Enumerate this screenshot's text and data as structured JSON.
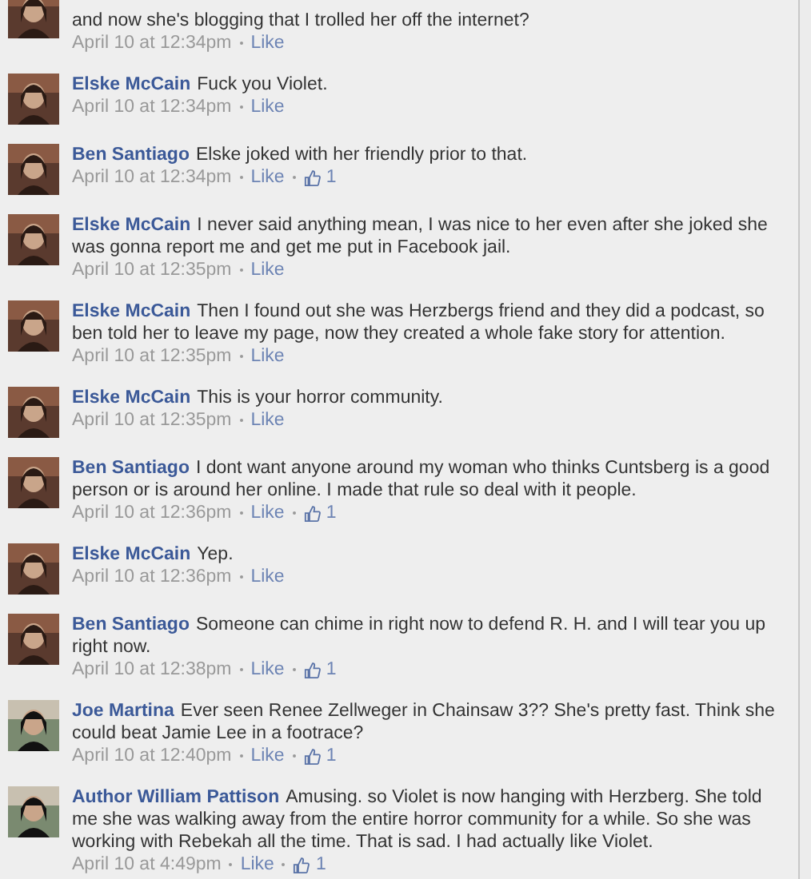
{
  "comments": [
    {
      "text": "and now she's blogging that I trolled her off the internet?",
      "time": "April 10 at 12:34pm",
      "like": "Like",
      "cut": true
    },
    {
      "name": "Elske McCain",
      "text": "Fuck you Violet.",
      "time": "April 10 at 12:34pm",
      "like": "Like"
    },
    {
      "name": "Ben Santiago",
      "text": "Elske joked with her friendly prior to that.",
      "time": "April 10 at 12:34pm",
      "like": "Like",
      "likes": "1"
    },
    {
      "name": "Elske McCain",
      "text": "I never said anything mean, I was nice to her even after she joked she was gonna report me and get me put in Facebook jail.",
      "time": "April 10 at 12:35pm",
      "like": "Like"
    },
    {
      "name": "Elske McCain",
      "text": "Then I found out she was Herzbergs friend and they did a podcast, so ben told her to leave my page, now they created a whole fake story for attention.",
      "time": "April 10 at 12:35pm",
      "like": "Like"
    },
    {
      "name": "Elske McCain",
      "text": "This is your horror community.",
      "time": "April 10 at 12:35pm",
      "like": "Like"
    },
    {
      "name": "Ben Santiago",
      "text": "I dont want anyone around my woman who thinks Cuntsberg is a good person or is around her online. I made that rule so deal with it people.",
      "time": "April 10 at 12:36pm",
      "like": "Like",
      "likes": "1"
    },
    {
      "name": "Elske McCain",
      "text": "Yep.",
      "time": "April 10 at 12:36pm",
      "like": "Like"
    },
    {
      "name": "Ben Santiago",
      "text": "Someone can chime in right now to defend R. H. and I will tear you up right now.",
      "time": "April 10 at 12:38pm",
      "like": "Like",
      "likes": "1"
    },
    {
      "name": "Joe Martina",
      "text": "Ever seen Renee Zellweger in Chainsaw 3?? She's pretty fast. Think she could beat Jamie Lee in a footrace?",
      "time": "April 10 at 12:40pm",
      "like": "Like",
      "likes": "1"
    },
    {
      "name": "Author William Pattison",
      "text": "Amusing. so Violet is now hanging with Herzberg. She told me she was walking away from the entire horror community for a while. So she was working with Rebekah all the time. That is sad. I had actually like Violet.",
      "time": "April 10 at 4:49pm",
      "like": "Like",
      "likes": "1"
    }
  ]
}
